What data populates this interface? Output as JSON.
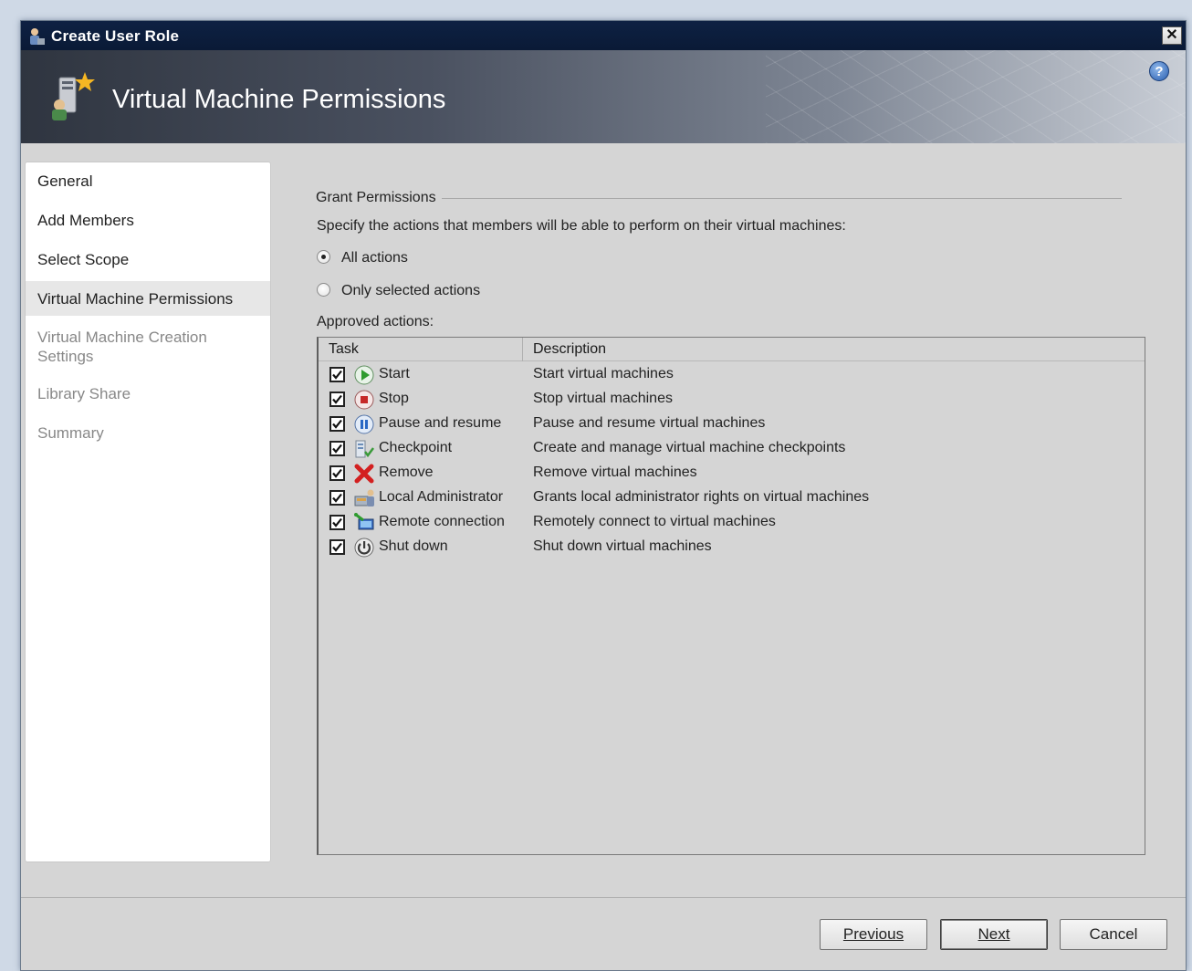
{
  "window": {
    "title": "Create User Role",
    "close_label": "✕"
  },
  "banner": {
    "page_title": "Virtual Machine Permissions",
    "help_label": "?"
  },
  "nav": {
    "items": [
      {
        "label": "General",
        "state": "normal"
      },
      {
        "label": "Add Members",
        "state": "normal"
      },
      {
        "label": "Select Scope",
        "state": "normal"
      },
      {
        "label": "Virtual Machine Permissions",
        "state": "active"
      },
      {
        "label": "Virtual Machine Creation Settings",
        "state": "disabled"
      },
      {
        "label": "Library Share",
        "state": "disabled"
      },
      {
        "label": "Summary",
        "state": "disabled"
      }
    ]
  },
  "permissions": {
    "group_label": "Grant Permissions",
    "instructions": "Specify the actions that members will be able to perform on their virtual machines:",
    "radio_all": {
      "label": "All actions",
      "checked": true
    },
    "radio_selected": {
      "label": "Only selected actions",
      "checked": false
    },
    "approved_label": "Approved actions:",
    "columns": {
      "task": "Task",
      "description": "Description"
    },
    "rows": [
      {
        "task": "Start",
        "description": "Start virtual machines",
        "checked": true,
        "icon": "start-icon"
      },
      {
        "task": "Stop",
        "description": "Stop virtual machines",
        "checked": true,
        "icon": "stop-icon"
      },
      {
        "task": "Pause and resume",
        "description": "Pause and resume virtual machines",
        "checked": true,
        "icon": "pause-icon"
      },
      {
        "task": "Checkpoint",
        "description": "Create and manage virtual machine checkpoints",
        "checked": true,
        "icon": "checkpoint-icon"
      },
      {
        "task": "Remove",
        "description": "Remove virtual machines",
        "checked": true,
        "icon": "remove-icon"
      },
      {
        "task": "Local Administrator",
        "description": "Grants local administrator rights on virtual machines",
        "checked": true,
        "icon": "local-admin-icon"
      },
      {
        "task": "Remote connection",
        "description": "Remotely connect to virtual machines",
        "checked": true,
        "icon": "remote-connection-icon"
      },
      {
        "task": "Shut down",
        "description": "Shut down virtual machines",
        "checked": true,
        "icon": "shutdown-icon"
      }
    ]
  },
  "buttons": {
    "previous": "Previous",
    "next": "Next",
    "cancel": "Cancel"
  },
  "colors": {
    "titlebar": "#0e2143",
    "start": "#2e9b2e",
    "stop": "#c62828",
    "pause": "#2a68c4",
    "remove": "#d32020"
  }
}
